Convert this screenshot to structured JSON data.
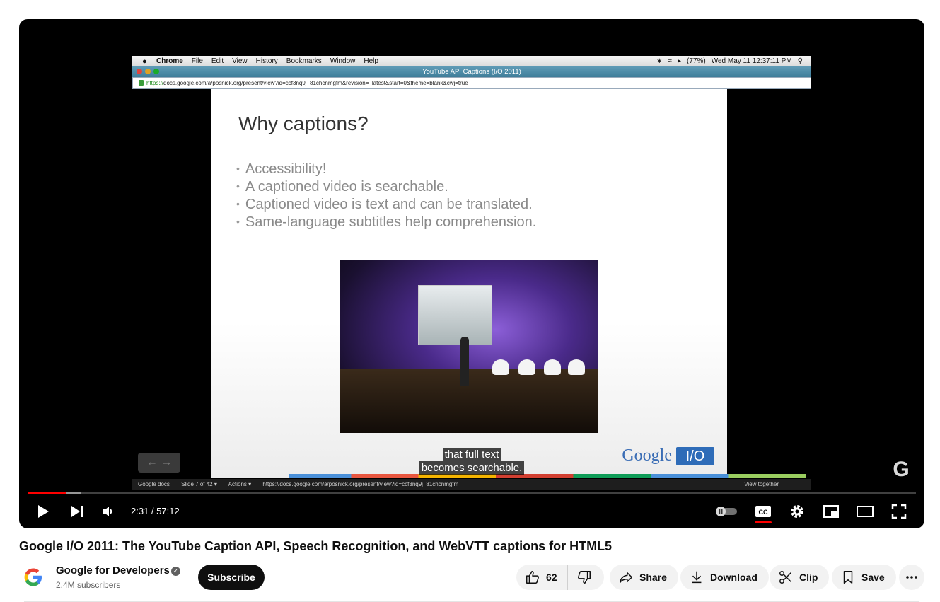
{
  "recording": {
    "menubar": {
      "app": "Chrome",
      "items": [
        "File",
        "Edit",
        "View",
        "History",
        "Bookmarks",
        "Window",
        "Help"
      ],
      "battery": "(77%)",
      "clock": "Wed May 11  12:37:11 PM"
    },
    "window_title": "YouTube API Captions (I/O 2011)",
    "url_scheme": "https://",
    "url_rest": "docs.google.com/a/posnick.org/present/view?id=ccf3nq9j_81chcnmgfm&revision=_latest&start=0&theme=blank&cwj=true",
    "slide": {
      "title": "Why captions?",
      "bullets": [
        "Accessibility!",
        "A captioned video is searchable.",
        "Captioned video is text and can be translated.",
        "Same-language subtitles help comprehension."
      ],
      "logo_google": "Google",
      "logo_io": "I/O"
    },
    "docs_bar": {
      "brand": "Google docs",
      "slide_counter": "Slide 7 of 42 ▾",
      "actions": "Actions ▾",
      "url": "https://docs.google.com/a/posnick.org/present/view?id=ccf3nq9j_81chcnmgfm",
      "view_together": "View together"
    }
  },
  "player": {
    "caption_lines": [
      "that full text",
      "becomes searchable."
    ],
    "time": "2:31 / 57:12",
    "progress_fraction": 0.044,
    "buffered_fraction": 0.06,
    "accent": "#ff0000"
  },
  "video": {
    "title": "Google I/O 2011: The YouTube Caption API, Speech Recognition, and WebVTT captions for HTML5",
    "channel_name": "Google for Developers",
    "subscribers": "2.4M subscribers",
    "subscribe_label": "Subscribe",
    "like_count": "62",
    "share_label": "Share",
    "download_label": "Download",
    "clip_label": "Clip",
    "save_label": "Save"
  }
}
